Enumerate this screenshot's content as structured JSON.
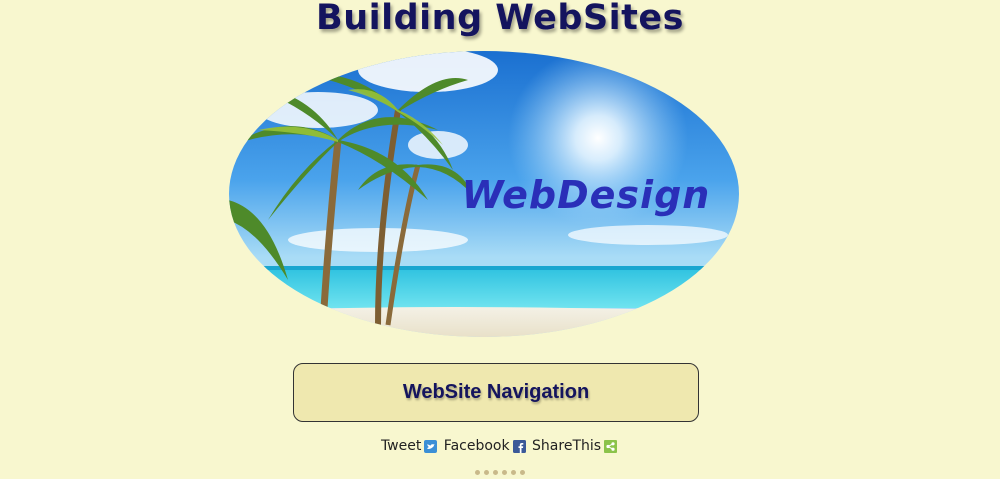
{
  "page": {
    "title": "Building WebSites"
  },
  "hero": {
    "logo_text": "WebDesign"
  },
  "nav": {
    "label": "WebSite Navigation"
  },
  "share": {
    "tweet_label": "Tweet",
    "facebook_label": "Facebook",
    "sharethis_label": "ShareThis",
    "tweet_icon": "twitter-icon",
    "facebook_icon": "facebook-icon",
    "sharethis_icon": "share-icon"
  },
  "colors": {
    "background": "#f8f7cf",
    "title": "#14145e",
    "nav_box": "#efe8af",
    "twitter": "#3b8fd6",
    "facebook": "#3b5998",
    "sharethis": "#8bc34a"
  }
}
